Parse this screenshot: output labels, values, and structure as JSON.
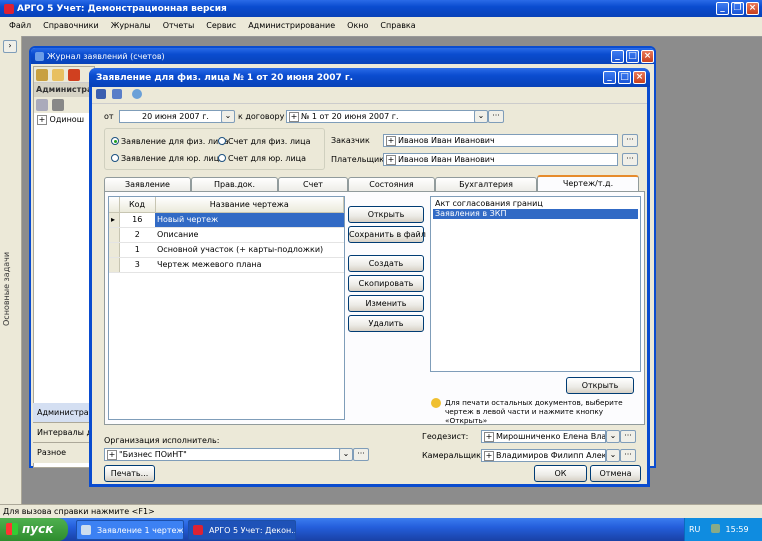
{
  "app": {
    "title": "АРГО 5 Учет: Демонстрационная версия",
    "menu": [
      "Файл",
      "Справочники",
      "Журналы",
      "Отчеты",
      "Сервис",
      "Администрирование",
      "Окно",
      "Справка"
    ],
    "side_vertical_label": "Основные задачи",
    "side_items": [
      "Администрати",
      "Интервалы да",
      "Разное"
    ]
  },
  "journal": {
    "title": "Журнал заявлений (счетов)",
    "tab_label": "Администрат",
    "tree_item": "Одинош"
  },
  "dialog": {
    "title": "Заявление для физ. лица № 1 от 20 июня 2007 г.",
    "from_label": "от",
    "date_value": "20 июня 2007 г.",
    "contract_label": "к договору",
    "contract_value": "№ 1 от 20 июня 2007 г.",
    "radios": [
      {
        "label": "Заявление для физ. лица",
        "checked": true
      },
      {
        "label": "Счет для физ. лица",
        "checked": false
      },
      {
        "label": "Заявление для юр. лица",
        "checked": false
      },
      {
        "label": "Счет для юр. лица",
        "checked": false
      }
    ],
    "customer_label": "Заказчик",
    "customer_value": "Иванов Иван Иванович",
    "payer_label": "Плательщик",
    "payer_value": "Иванов Иван Иванович",
    "tabs": [
      "Заявление",
      "Прав.док.",
      "Счет",
      "Состояния",
      "Бухгалтерия",
      "Чертеж/т.д."
    ],
    "grid_headers": [
      "Код",
      "Название чертежа"
    ],
    "grid_rows": [
      {
        "code": "16",
        "name": "Новый чертеж"
      },
      {
        "code": "2",
        "name": "Описание"
      },
      {
        "code": "1",
        "name": "Основной участок (+ карты-подложки)"
      },
      {
        "code": "3",
        "name": "Чертеж межевого плана"
      }
    ],
    "buttons": [
      "Открыть",
      "Сохранить в файл",
      "Создать",
      "Скопировать",
      "Изменить",
      "Удалить"
    ],
    "docs": [
      "Акт согласования границ",
      "Заявления в ЗКП"
    ],
    "docs_open": "Открыть",
    "hint": "Для печати остальных документов, выберите чертеж в левой части и нажмите кнопку «Открыть»",
    "org_label": "Организация исполнитель:",
    "org_value": "\"Бизнес ПОиНТ\"",
    "geodesist_label": "Геодезист:",
    "geodesist_value": "Мирошниченко Елена Владими",
    "cameral_label": "Камеральщик:",
    "cameral_value": "Владимиров Филипп Алексан",
    "print": "Печать...",
    "ok": "ОК",
    "cancel": "Отмена"
  },
  "status_text": "Для вызова справки нажмите <F1>",
  "taskbar": {
    "start": "пуск",
    "tasks": [
      "Заявление 1 чертеж...",
      "АРГО 5 Учет: Декон..."
    ],
    "lang": "RU",
    "time": "15:59"
  }
}
